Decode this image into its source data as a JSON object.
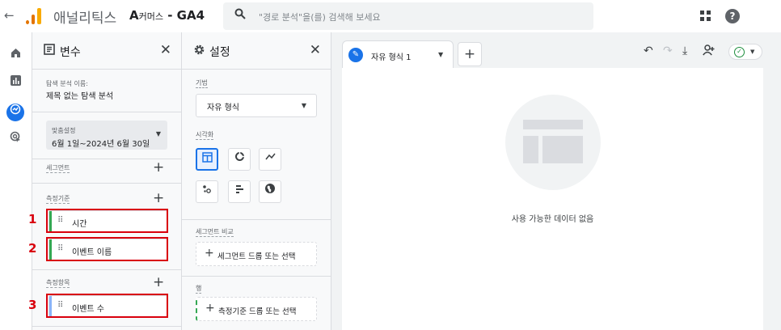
{
  "app": {
    "title": "애널리틱스",
    "property_prefix": "A",
    "property_small": "커머스",
    "property_suffix": " - GA4",
    "search_placeholder": "\"경로 분석\"을(를) 검색해 보세요",
    "help": "?"
  },
  "rail": [
    "home-icon",
    "reports-icon",
    "explore-icon",
    "advertising-icon"
  ],
  "variables": {
    "title": "변수",
    "exploration_name_label": "탐색 분석 이름:",
    "exploration_name": "제목 없는 탐색 분석",
    "date_label": "맞춤설정",
    "date_range": "6월 1일~2024년 6월 30일",
    "segments_label": "세그먼트",
    "dimensions_label": "측정기준",
    "dimensions": [
      "시간",
      "이벤트 이름"
    ],
    "metrics_label": "측정항목",
    "metrics": [
      "이벤트 수"
    ],
    "annotations": [
      "1",
      "2",
      "3"
    ]
  },
  "settings": {
    "title": "설정",
    "technique_label": "기법",
    "technique_value": "자유 형식",
    "viz_label": "시각화",
    "segment_compare_label": "세그먼트 비교",
    "segment_drop": "세그먼트 드롭 또는 선택",
    "rows_label": "행",
    "rows_drop": "측정기준 드롭 또는 선택"
  },
  "canvas": {
    "tab_name": "자유 형식 1",
    "add_tab": "+",
    "empty_message": "사용 가능한 데이터 없음"
  },
  "colors": {
    "accent": "#1a73e8",
    "dimension_bar": "#34a853",
    "metric_bar": "#8ab4f8",
    "annotation_red": "#d9000d"
  }
}
